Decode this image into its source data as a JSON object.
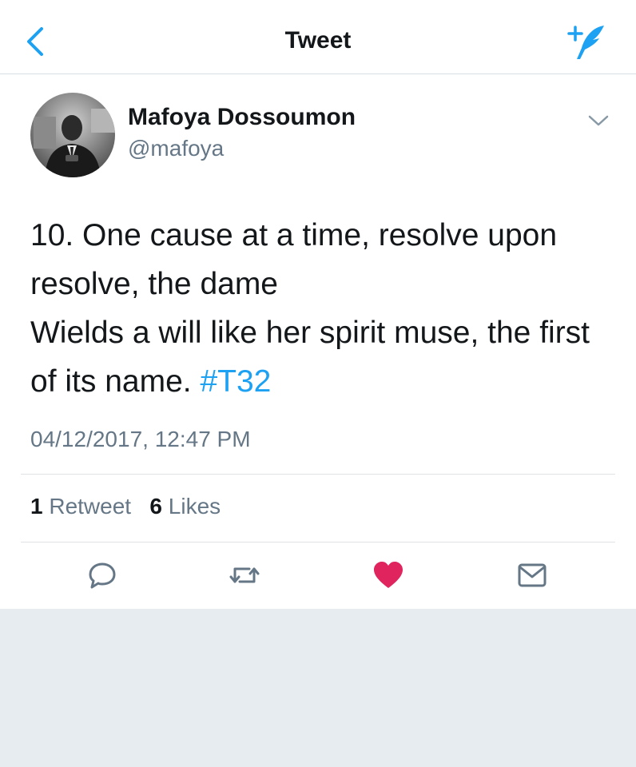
{
  "header": {
    "title": "Tweet",
    "back_icon": "chevron-left-icon",
    "compose_icon": "compose-tweet-icon"
  },
  "author": {
    "display_name": "Mafoya Dossoumon",
    "handle": "@mafoya"
  },
  "tweet": {
    "lines": [
      "10. One cause at a time, resolve upon",
      "resolve, the dame",
      "Wields a will like her spirit muse, the first",
      "of its name."
    ],
    "hashtag": "#T32",
    "timestamp": "04/12/2017, 12:47 PM"
  },
  "stats": {
    "retweets_count": "1",
    "retweets_label": "Retweet",
    "likes_count": "6",
    "likes_label": "Likes"
  },
  "actions": [
    "reply-icon",
    "retweet-icon",
    "heart-icon",
    "mail-icon"
  ],
  "colors": {
    "accent": "#1da1f2",
    "like": "#e0245e",
    "text": "#14171a",
    "muted": "#657786",
    "background": "#e6ecf0"
  }
}
